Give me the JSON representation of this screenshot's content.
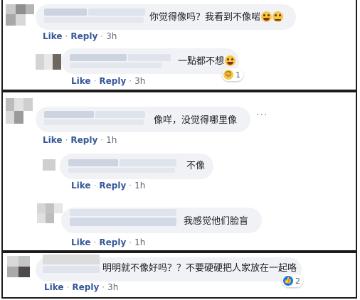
{
  "colors": {
    "bubble": "#f0f2f5",
    "link": "#365899",
    "meta": "#606770",
    "border": "#1c1c1c",
    "like_blue": "#1877f2",
    "haha_yellow": "#f7c744"
  },
  "panel1": {
    "comment": {
      "text": "你觉得像吗？我看到不像啱",
      "emojis": [
        "rolling-on-floor-laughing-icon",
        "thinking-face-icon"
      ],
      "actions": {
        "like": "Like",
        "reply": "Reply",
        "time": "3h"
      }
    },
    "reply": {
      "text": "一點都不想",
      "emoji": "laughing-face-icon",
      "reaction_count": "1",
      "actions": {
        "like": "Like",
        "reply": "Reply",
        "time": "3h"
      }
    }
  },
  "panel2": {
    "comment": {
      "text": "像咩，没觉得哪里像",
      "actions": {
        "like": "Like",
        "reply": "Reply",
        "time": "1h"
      },
      "more_icon": "more-options-icon"
    },
    "reply1": {
      "text": "不像",
      "actions": {
        "like": "Like",
        "reply": "Reply",
        "time": "1h"
      }
    },
    "reply2": {
      "text": "我感觉他们脸盲",
      "actions": {
        "like": "Like",
        "reply": "Reply",
        "time": "1h"
      }
    }
  },
  "panel3": {
    "comment": {
      "text": "明明就不像好吗？？不要硬硬把人家放在一起咯",
      "reaction_count": "2",
      "actions": {
        "like": "Like",
        "reply": "Reply",
        "time": "3h"
      }
    }
  }
}
